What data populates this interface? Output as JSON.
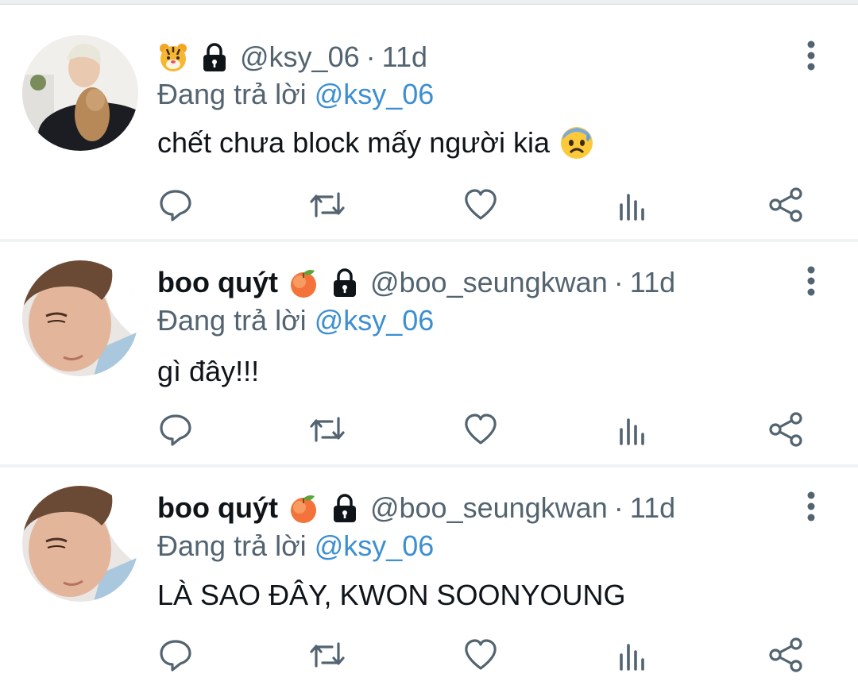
{
  "tweets": [
    {
      "display_name": "",
      "display_emoji": "tiger-face",
      "locked": true,
      "handle": "@ksy_06",
      "separator": "·",
      "time": "11d",
      "reply_prefix": "Đang trả lời",
      "reply_to": "@ksy_06",
      "text": "chết chưa block mấy người kia",
      "text_emoji": "anxious-face-with-sweat"
    },
    {
      "display_name": "boo quýt",
      "display_emoji": "peach",
      "locked": true,
      "handle": "@boo_seungkwan",
      "separator": "·",
      "time": "11d",
      "reply_prefix": "Đang trả lời",
      "reply_to": "@ksy_06",
      "text": "gì đây!!!"
    },
    {
      "display_name": "boo quýt",
      "display_emoji": "peach",
      "locked": true,
      "handle": "@boo_seungkwan",
      "separator": "·",
      "time": "11d",
      "reply_prefix": "Đang trả lời",
      "reply_to": "@ksy_06",
      "text": "LÀ SAO ĐÂY, KWON SOONYOUNG"
    }
  ],
  "icons": {
    "reply": "reply-icon",
    "retweet": "retweet-icon",
    "like": "like-icon",
    "views": "views-icon",
    "share": "share-icon",
    "more": "more-icon"
  },
  "colors": {
    "text": "#0f1419",
    "secondary": "#536471",
    "mention": "#3d8fd1",
    "divider": "#eff3f4"
  }
}
